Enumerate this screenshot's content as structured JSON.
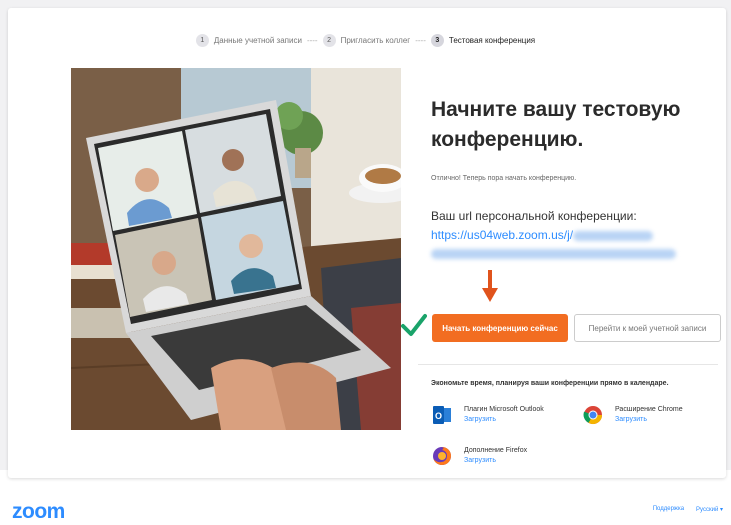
{
  "stepper": {
    "steps": [
      {
        "num": "1",
        "label": "Данные учетной записи"
      },
      {
        "num": "2",
        "label": "Пригласить коллег"
      },
      {
        "num": "3",
        "label": "Тестовая конференция"
      }
    ],
    "separator": "----",
    "active_index": 2
  },
  "main": {
    "title": "Начните вашу тестовую конференцию.",
    "subtitle": "Отлично! Теперь пора начать конференцию.",
    "url_label": "Ваш url персональной конференции:",
    "url_prefix": "https://us04web.zoom.us/j/",
    "start_button": "Начать конференцию сейчас",
    "account_button": "Перейти к моей учетной записи"
  },
  "calendar": {
    "title": "Экономьте время, планируя ваши конференции прямо в календаре.",
    "integrations": [
      {
        "name": "Плагин Microsoft Outlook",
        "link": "Загрузить",
        "icon": "outlook-icon"
      },
      {
        "name": "Расширение Chrome",
        "link": "Загрузить",
        "icon": "chrome-icon"
      },
      {
        "name": "Дополнение Firefox",
        "link": "Загрузить",
        "icon": "firefox-icon"
      }
    ]
  },
  "footer": {
    "logo": "zoom",
    "support": "Поддержка",
    "language": "Русский ▾"
  },
  "colors": {
    "accent": "#2d8cff",
    "primary_button": "#f26d21",
    "checkmark": "#1aa36a",
    "arrow": "#e0531c"
  }
}
